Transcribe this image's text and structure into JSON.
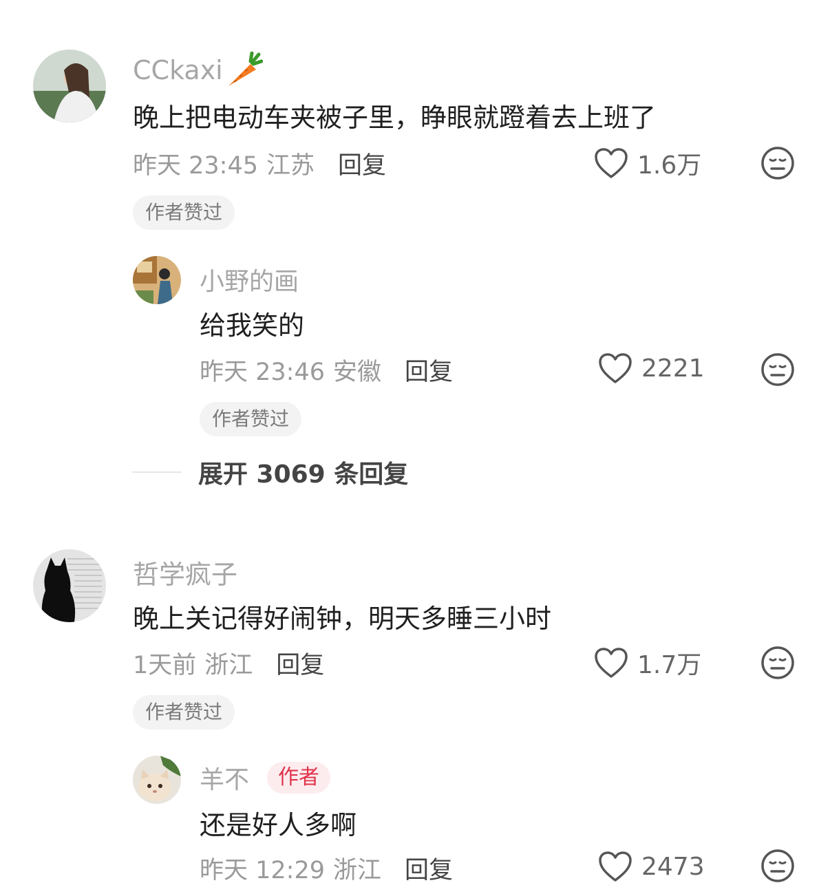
{
  "comments": [
    {
      "username": "CCkaxi",
      "username_emoji": "🥕",
      "text": "晚上把电动车夹被子里，睁眼就蹬着去上班了",
      "time": "昨天 23:45",
      "location": "江苏",
      "reply_label": "回复",
      "likes": "1.6万",
      "badge": "作者赞过"
    },
    {
      "username": "小野的画",
      "text": "给我笑的",
      "time": "昨天 23:46",
      "location": "安徽",
      "reply_label": "回复",
      "likes": "2221",
      "badge": "作者赞过"
    },
    {
      "username": "哲学疯子",
      "text": "晚上关记得好闹钟，明天多睡三小时",
      "time": "1天前",
      "location": "浙江",
      "reply_label": "回复",
      "likes": "1.7万",
      "badge": "作者赞过"
    },
    {
      "username": "羊不",
      "author_tag": "作者",
      "text": "还是好人多啊",
      "time": "昨天 12:29",
      "location": "浙江",
      "reply_label": "回复",
      "likes": "2473"
    }
  ],
  "expand_replies": "展开 3069 条回复",
  "colors": {
    "username": "#a6a6a6",
    "meta": "#9a9a9a",
    "author_tag_bg": "#fdecee",
    "author_tag_text": "#e0334a",
    "badge_bg": "#f3f3f3"
  },
  "icons": [
    "heart-icon",
    "dislike-face-icon",
    "carrot-emoji"
  ]
}
